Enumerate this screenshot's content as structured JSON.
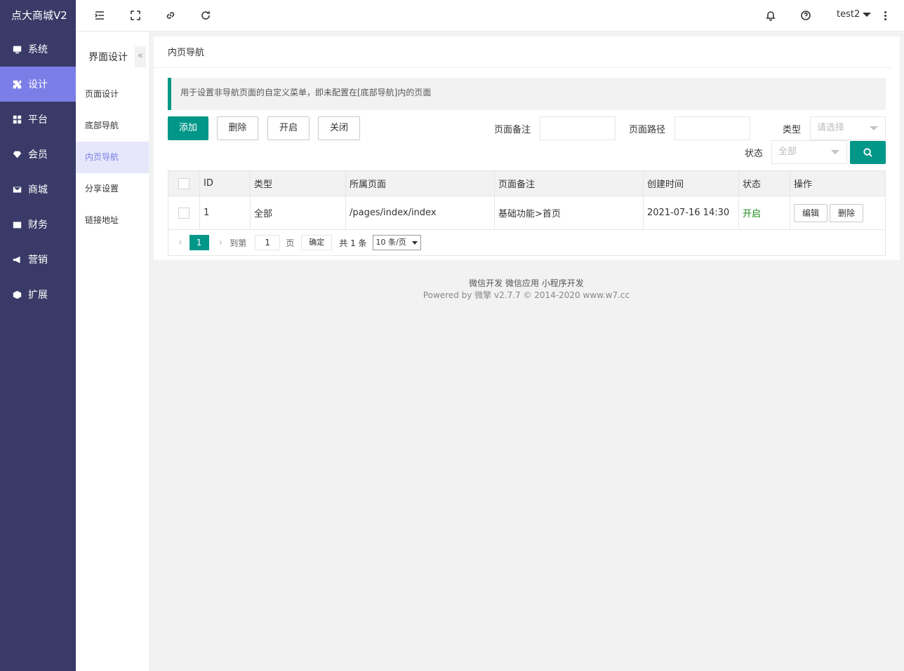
{
  "app": {
    "logo": "点大商城V2"
  },
  "sidebar": {
    "items": [
      {
        "label": "系统",
        "icon": "monitor-icon"
      },
      {
        "label": "设计",
        "icon": "puzzle-icon"
      },
      {
        "label": "平台",
        "icon": "grid-icon"
      },
      {
        "label": "会员",
        "icon": "diamond-icon"
      },
      {
        "label": "商城",
        "icon": "mail-icon"
      },
      {
        "label": "财务",
        "icon": "wallet-icon"
      },
      {
        "label": "营销",
        "icon": "megaphone-icon"
      },
      {
        "label": "扩展",
        "icon": "cube-icon"
      }
    ],
    "active": "设计"
  },
  "header": {
    "user": "test2"
  },
  "subnav": {
    "title": "界面设计",
    "collapse": "«",
    "items": [
      {
        "label": "页面设计"
      },
      {
        "label": "底部导航"
      },
      {
        "label": "内页导航"
      },
      {
        "label": "分享设置"
      },
      {
        "label": "链接地址"
      }
    ]
  },
  "main": {
    "title": "内页导航",
    "notice": "用于设置非导航页面的自定义菜单，即未配置在[底部导航]内的页面",
    "buttons": {
      "add": "添加",
      "delete": "删除",
      "open": "开启",
      "close": "关闭"
    },
    "filters": {
      "remark_label": "页面备注",
      "path_label": "页面路径",
      "type_label": "类型",
      "type_placeholder": "请选择",
      "status_label": "状态",
      "status_value": "全部"
    },
    "table": {
      "headers": [
        "ID",
        "类型",
        "所属页面",
        "页面备注",
        "创建时间",
        "状态",
        "操作"
      ],
      "rows": [
        {
          "id": "1",
          "type": "全部",
          "page": "/pages/index/index",
          "remark": "基础功能>首页",
          "created": "2021-07-16 14:30",
          "status": "开启",
          "edit": "编辑",
          "del": "删除"
        }
      ]
    },
    "pager": {
      "current": "1",
      "goto": "到第",
      "goto_value": "1",
      "page_unit": "页",
      "confirm": "确定",
      "total": "共 1 条",
      "size": "10 条/页"
    }
  },
  "footer": {
    "links": "微信开发 微信应用 小程序开发",
    "powered": "Powered by 微擎 v2.7.7 © 2014-2020 www.w7.cc"
  },
  "colors": {
    "sidebar": "#393a67",
    "active": "#7b7ee7",
    "primary": "#009688"
  }
}
